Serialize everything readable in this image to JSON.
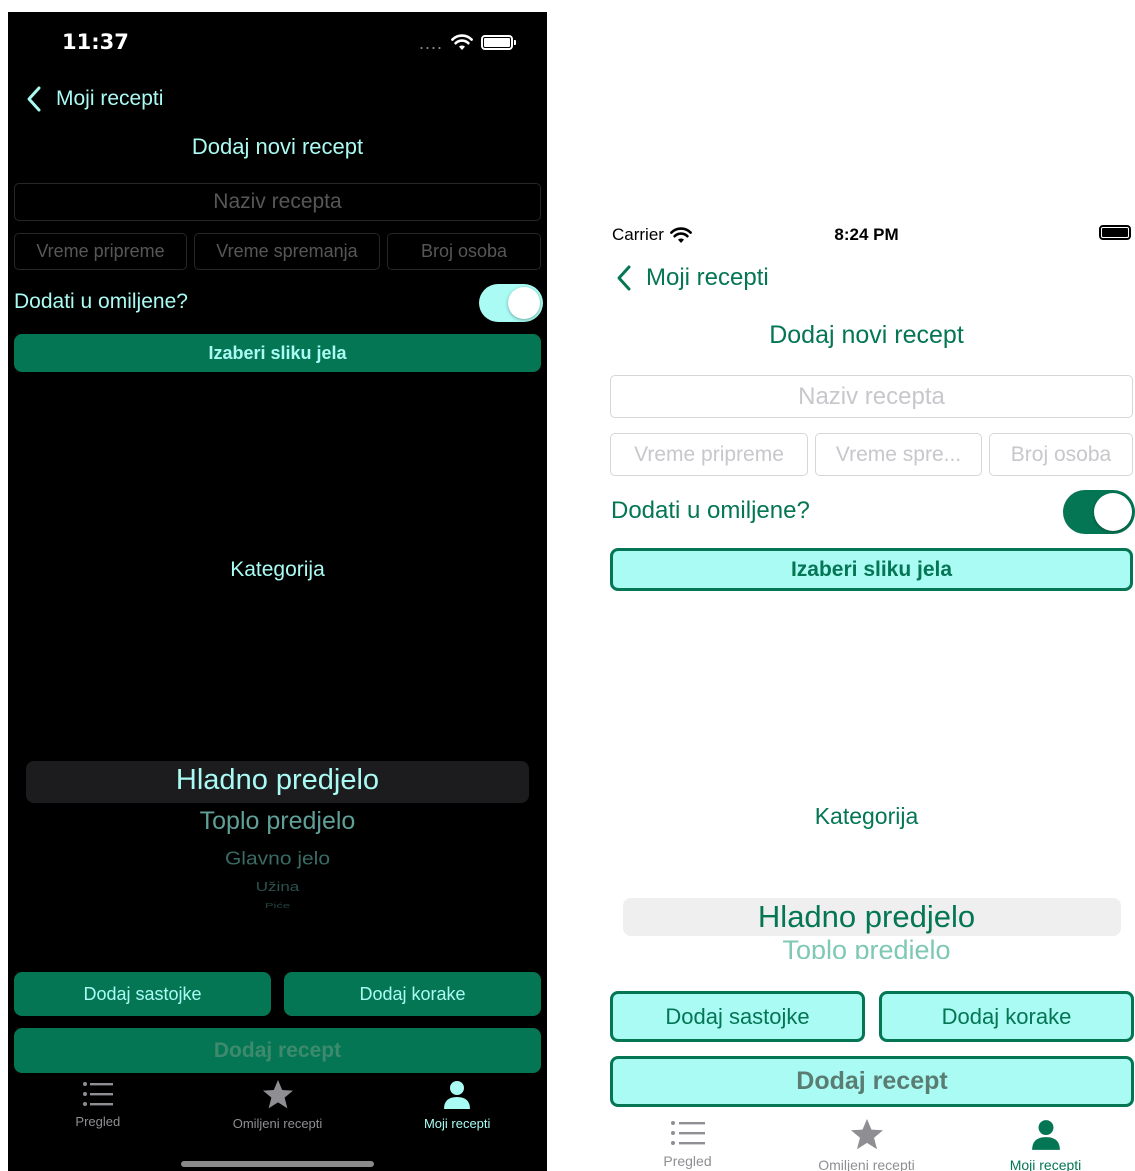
{
  "dark": {
    "status": {
      "time": "11:37"
    },
    "nav": {
      "back_label": "Moji recepti"
    },
    "title": "Dodaj novi recept",
    "form": {
      "name_placeholder": "Naziv recepta",
      "prep_placeholder": "Vreme pripreme",
      "cook_placeholder": "Vreme spremanja",
      "servings_placeholder": "Broj osoba",
      "favorite_label": "Dodati u omiljene?",
      "favorite_on": true,
      "pick_image_label": "Izaberi sliku jela"
    },
    "category_label": "Kategorija",
    "picker": [
      "Hladno predjelo",
      "Toplo predjelo",
      "Glavno jelo",
      "Užina",
      "Piće"
    ],
    "actions": {
      "ingredients_label": "Dodaj sastojke",
      "steps_label": "Dodaj korake",
      "submit_label": "Dodaj recept"
    },
    "tabs": [
      {
        "label": "Pregled",
        "icon": "list-icon"
      },
      {
        "label": "Omiljeni recepti",
        "icon": "star-icon"
      },
      {
        "label": "Moji recepti",
        "icon": "person-icon"
      }
    ]
  },
  "light": {
    "status": {
      "carrier": "Carrier",
      "time": "8:24 PM"
    },
    "nav": {
      "back_label": "Moji recepti"
    },
    "title": "Dodaj novi recept",
    "form": {
      "name_placeholder": "Naziv recepta",
      "prep_placeholder": "Vreme pripreme",
      "cook_placeholder": "Vreme spre...",
      "servings_placeholder": "Broj osoba",
      "favorite_label": "Dodati u omiljene?",
      "favorite_on": true,
      "pick_image_label": "Izaberi sliku jela"
    },
    "category_label": "Kategorija",
    "picker": [
      "Hladno predjelo",
      "Toplo predjelo"
    ],
    "actions": {
      "ingredients_label": "Dodaj sastojke",
      "steps_label": "Dodaj korake",
      "submit_label": "Dodaj recept"
    },
    "tabs": [
      {
        "label": "Pregled",
        "icon": "list-icon"
      },
      {
        "label": "Omiljeni recepti",
        "icon": "star-icon"
      },
      {
        "label": "Moji recepti",
        "icon": "person-icon"
      }
    ]
  },
  "colors": {
    "accent": "#047654",
    "accent_light": "#a9fbf3",
    "tab_inactive": "#8e8e93"
  }
}
